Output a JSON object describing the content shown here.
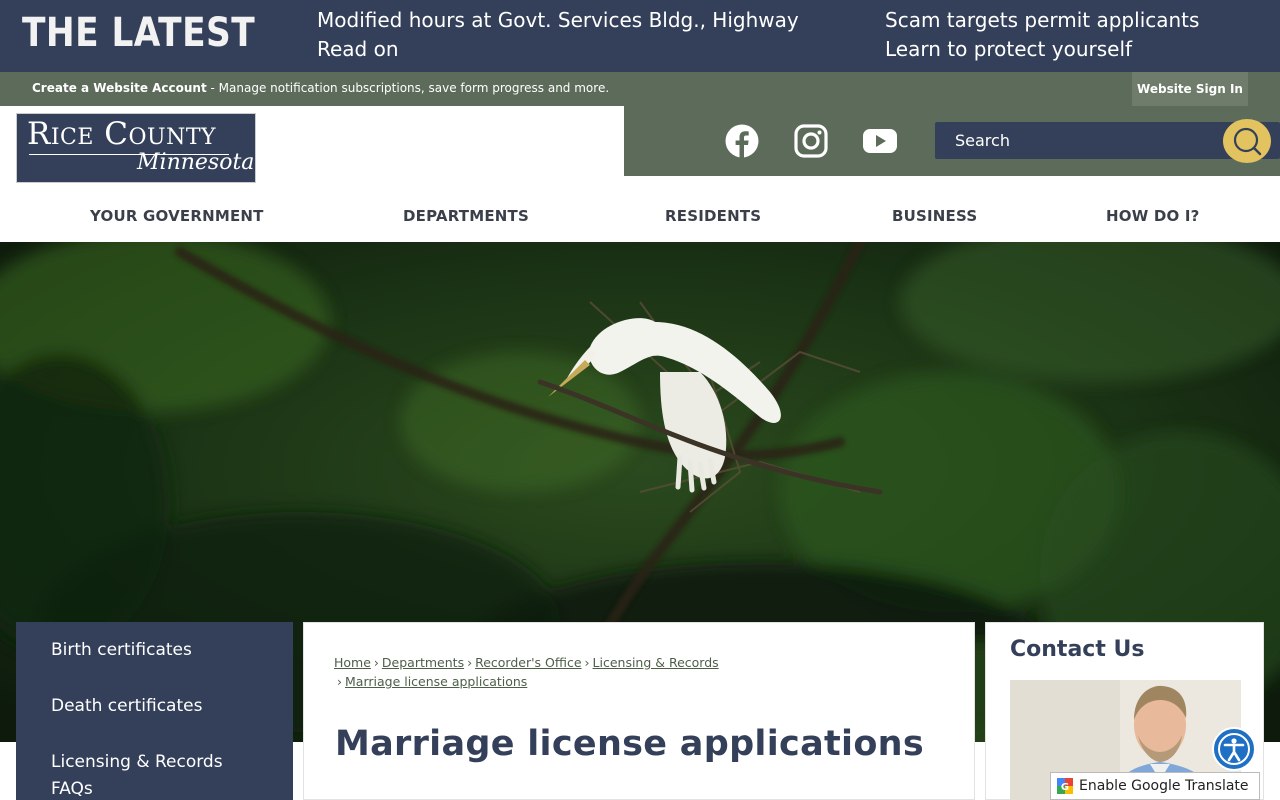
{
  "latest": {
    "title": "THE LATEST",
    "items": [
      {
        "line1": "Modified hours at Govt. Services Bldg., Highway",
        "line2": "Read on"
      },
      {
        "line1": "Scam targets permit applicants",
        "line2": "Learn to protect yourself"
      }
    ]
  },
  "account": {
    "create_label": "Create a Website Account",
    "description": " - Manage notification subscriptions, save form progress and more.",
    "signin_label": "Website Sign In"
  },
  "logo": {
    "line1": "Rice County",
    "line2": "Minnesota"
  },
  "social": {
    "icons": [
      "facebook-icon",
      "instagram-icon",
      "youtube-icon"
    ]
  },
  "search": {
    "placeholder": "Search"
  },
  "nav": {
    "items": [
      "YOUR GOVERNMENT",
      "DEPARTMENTS",
      "RESIDENTS",
      "BUSINESS",
      "HOW DO I?"
    ]
  },
  "side_menu": {
    "items": [
      {
        "label": "Birth certificates"
      },
      {
        "label": "Death certificates"
      },
      {
        "label": "Licensing & Records FAQs"
      }
    ]
  },
  "breadcrumb": {
    "items": [
      "Home",
      "Departments",
      "Recorder's Office",
      "Licensing & Records",
      "Marriage license applications"
    ]
  },
  "page": {
    "title": "Marriage license applications"
  },
  "contact": {
    "title": "Contact Us"
  },
  "widgets": {
    "translate_label": "Enable Google Translate",
    "accessibility_icon": "accessibility-icon"
  },
  "colors": {
    "navy": "#34405a",
    "green": "#5d6b5a",
    "gold": "#e2c35f"
  }
}
